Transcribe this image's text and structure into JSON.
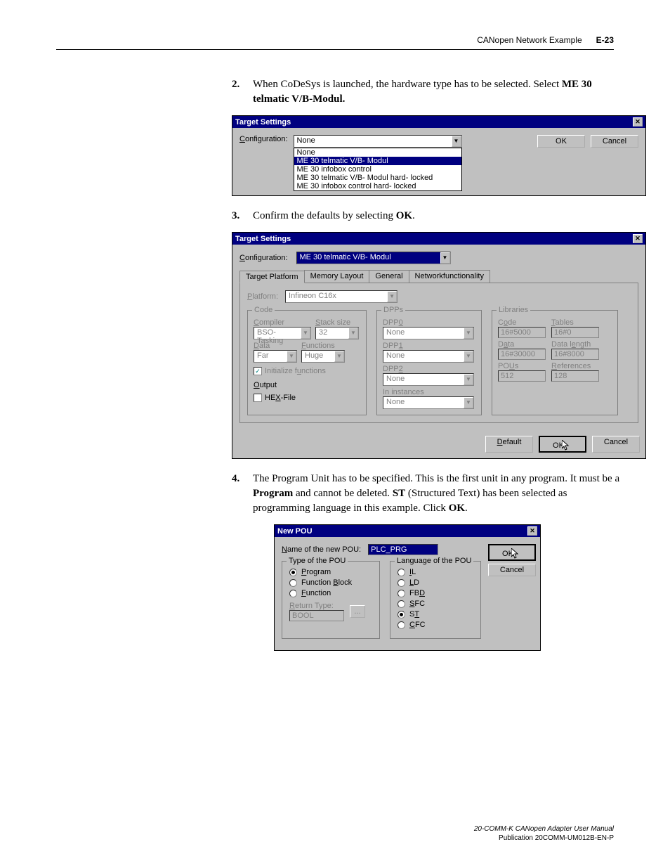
{
  "header": {
    "left": "CANopen Network Example",
    "right": "E-23"
  },
  "step2": {
    "num": "2.",
    "text_a": "When CoDeSys is launched, the hardware type has to be selected. Select ",
    "bold": "ME 30 telmatic V/B-Modul."
  },
  "step3": {
    "num": "3.",
    "text_a": "Confirm the defaults by selecting ",
    "bold": "OK",
    "text_b": "."
  },
  "step4": {
    "num": "4.",
    "text_a": "The Program Unit has to be specified. This is the first unit in any program. It must be a ",
    "bold1": "Program",
    "mid1": " and cannot be deleted. ",
    "bold2": "ST",
    "mid2": " (Structured Text) has been selected as programming language in this example. Click ",
    "bold3": "OK",
    "end": "."
  },
  "dlg1": {
    "title": "Target Settings",
    "config_label": "Configuration:",
    "selected": "None",
    "options": [
      "None",
      "ME 30 telmatic V/B- Modul",
      "ME 30 infobox control",
      "ME 30 telmatic V/B- Modul hard- locked",
      "ME 30 infobox control hard- locked"
    ],
    "ok": "OK",
    "cancel": "Cancel"
  },
  "dlg2": {
    "title": "Target Settings",
    "config_label": "Configuration:",
    "config_value": "ME 30 telmatic V/B- Modul",
    "tabs": [
      "Target Platform",
      "Memory Layout",
      "General",
      "Networkfunctionality"
    ],
    "platform_label": "Platform:",
    "platform_value": "Infineon C16x",
    "code": {
      "title": "Code",
      "compiler": "Compiler",
      "compiler_val": "BSO-Tasking",
      "stack": "Stack size",
      "stack_val": "32",
      "data": "Data",
      "data_val": "Far",
      "functions": "Functions",
      "functions_val": "Huge",
      "init": "Initialize functions",
      "output": "Output",
      "hex": "HEX-File"
    },
    "dpps": {
      "title": "DPPs",
      "dpp0": "DPP0",
      "dpp0_val": "None",
      "dpp1": "DPP1",
      "dpp1_val": "None",
      "dpp2": "DPP2",
      "dpp2_val": "None",
      "inst": "In instances",
      "inst_val": "None"
    },
    "libs": {
      "title": "Libraries",
      "code": "Code",
      "code_val": "16#5000",
      "tables": "Tables",
      "tables_val": "16#0",
      "data": "Data",
      "data_val": "16#30000",
      "dlen": "Data length",
      "dlen_val": "16#8000",
      "pous": "POUs",
      "pous_val": "512",
      "refs": "References",
      "refs_val": "128"
    },
    "default": "Default",
    "ok": "OK",
    "cancel": "Cancel"
  },
  "dlg3": {
    "title": "New POU",
    "name_label": "Name of the new POU:",
    "name_value": "PLC_PRG",
    "type_title": "Type of the POU",
    "types": [
      "Program",
      "Function Block",
      "Function"
    ],
    "return_label": "Return Type:",
    "return_val": "BOOL",
    "lang_title": "Language of the POU",
    "langs": [
      "IL",
      "LD",
      "FBD",
      "SFC",
      "ST",
      "CFC"
    ],
    "ok": "OK",
    "cancel": "Cancel"
  },
  "footer": {
    "line1": "20-COMM-K CANopen Adapter User Manual",
    "line2": "Publication 20COMM-UM012B-EN-P"
  }
}
